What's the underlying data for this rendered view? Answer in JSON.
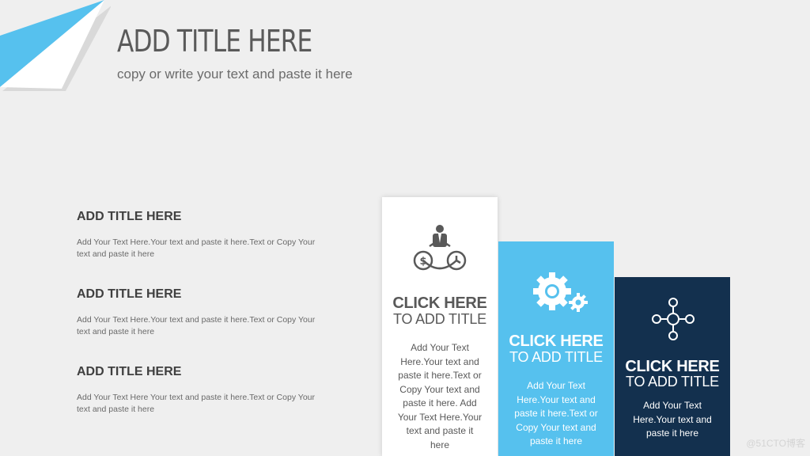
{
  "colors": {
    "background": "#efefef",
    "accent_blue": "#56c1ee",
    "navy": "#13304e",
    "card_white": "#ffffff",
    "text_dark": "#3f3f3f",
    "text_gray": "#6a6a6a"
  },
  "header": {
    "title": "ADD TITLE HERE",
    "subtitle": "copy or write your text and paste it here"
  },
  "items": [
    {
      "title": "ADD TITLE HERE",
      "text": "Add Your Text Here.Your text and paste it here.Text or Copy Your text and paste it here"
    },
    {
      "title": "ADD TITLE HERE",
      "text": "Add Your Text Here.Your text and paste it here.Text or Copy Your text and paste it here"
    },
    {
      "title": "ADD TITLE HERE",
      "text": "Add Your Text Here Your text and paste it here.Text or Copy Your text and paste it here"
    }
  ],
  "cards": [
    {
      "icon": "businessman-money-clock-icon",
      "line1": "CLICK HERE",
      "line2": "TO ADD TITLE",
      "text": "Add Your Text Here.Your text and paste it here.Text or Copy Your text and paste it here. Add Your Text Here.Your text and paste it here"
    },
    {
      "icon": "gears-icon",
      "line1": "CLICK HERE",
      "line2": "TO ADD TITLE",
      "text": "Add Your Text Here.Your text and paste it here.Text or Copy Your text and paste it here"
    },
    {
      "icon": "network-nodes-icon",
      "line1": "CLICK HERE",
      "line2": "TO ADD TITLE",
      "text": "Add Your Text Here.Your text and paste it here"
    }
  ],
  "watermark": "@51CTO博客"
}
